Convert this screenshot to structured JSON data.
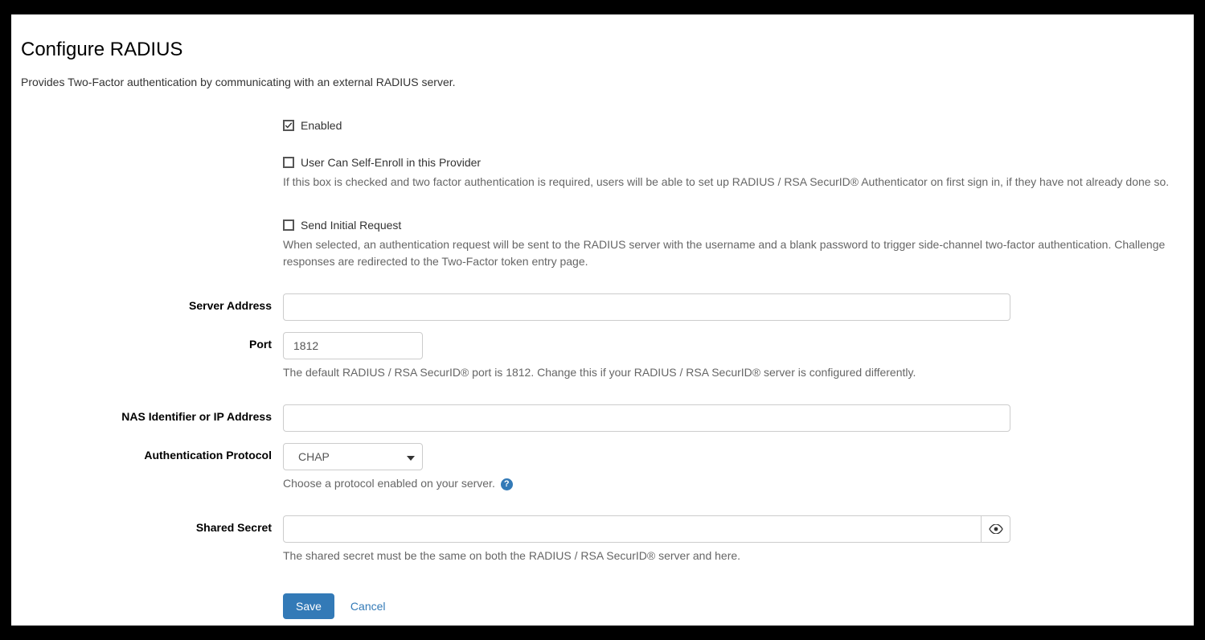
{
  "title": "Configure RADIUS",
  "description": "Provides Two-Factor authentication by communicating with an external RADIUS server.",
  "enabled": {
    "label": "Enabled",
    "checked": true
  },
  "selfEnroll": {
    "label": "User Can Self-Enroll in this Provider",
    "checked": false,
    "hint": "If this box is checked and two factor authentication is required, users will be able to set up RADIUS / RSA SecurID® Authenticator on first sign in, if they have not already done so."
  },
  "sendInitial": {
    "label": "Send Initial Request",
    "checked": false,
    "hint": "When selected, an authentication request will be sent to the RADIUS server with the username and a blank password to trigger side-channel two-factor authentication. Challenge responses are redirected to the Two-Factor token entry page."
  },
  "server": {
    "label": "Server Address",
    "value": ""
  },
  "port": {
    "label": "Port",
    "value": "1812",
    "hint": "The default RADIUS / RSA SecurID® port is 1812. Change this if your RADIUS / RSA SecurID® server is configured differently."
  },
  "nas": {
    "label": "NAS Identifier or IP Address",
    "value": ""
  },
  "authProto": {
    "label": "Authentication Protocol",
    "value": "CHAP",
    "hint": "Choose a protocol enabled on your server."
  },
  "sharedSecret": {
    "label": "Shared Secret",
    "value": "",
    "hint": "The shared secret must be the same on both the RADIUS / RSA SecurID® server and here."
  },
  "buttons": {
    "save": "Save",
    "cancel": "Cancel"
  }
}
